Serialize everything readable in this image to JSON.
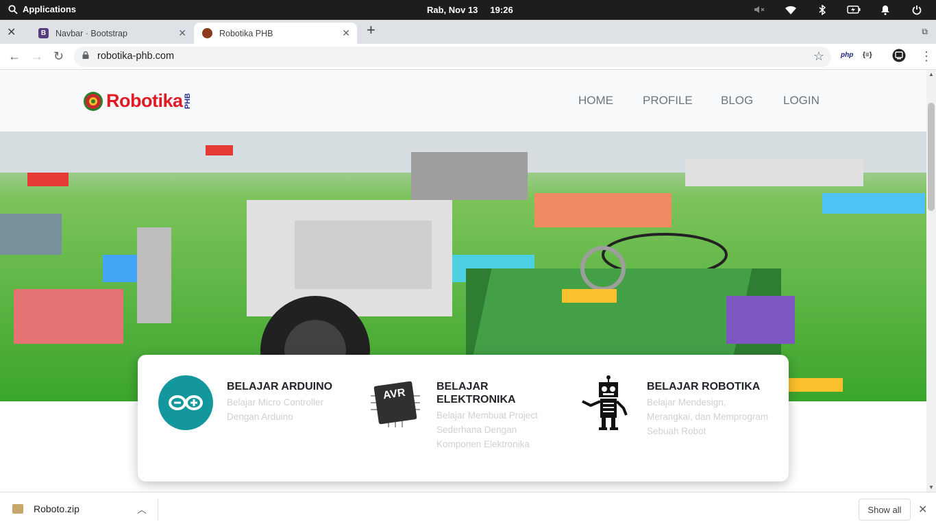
{
  "system": {
    "applications_label": "Applications",
    "date": "Rab, Nov 13",
    "time": "19:26"
  },
  "browser": {
    "tabs": [
      {
        "title": "Navbar · Bootstrap",
        "favicon": "B",
        "favicon_color": "#563d7c"
      },
      {
        "title": "Robotika PHB",
        "favicon_color": "#c0392b"
      }
    ],
    "url": "robotika-phb.com",
    "extensions": [
      "php",
      "{≡}"
    ]
  },
  "site": {
    "logo_text": "Robotika",
    "logo_sub": "PHB",
    "nav": [
      "HOME",
      "PROFILE",
      "BLOG",
      "LOGIN"
    ],
    "features": [
      {
        "title": "BELAJAR ARDUINO",
        "desc": "Belajar Micro Controller Dengan Arduino",
        "icon": "arduino-logo-icon"
      },
      {
        "title": "BELAJAR ELEKTRONIKA",
        "desc": "Belajar Membuat Project Sederhana Dengan Komponen Elektronika",
        "icon": "avr-chip-icon"
      },
      {
        "title": "BELAJAR ROBOTIKA",
        "desc": "Belajar Mendesign, Merangkai, dan Memprogram Sebuah Robot",
        "icon": "robot-icon"
      }
    ]
  },
  "downloads": {
    "file": "Roboto.zip",
    "show_all": "Show all"
  }
}
